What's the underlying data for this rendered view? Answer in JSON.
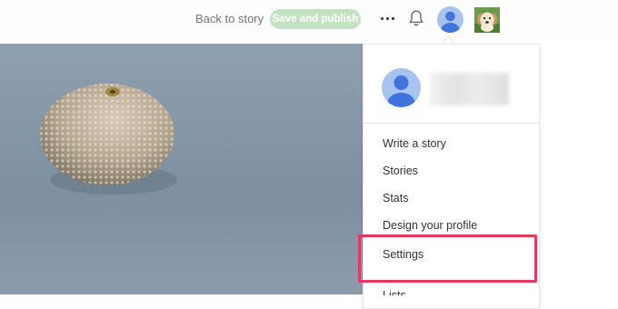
{
  "header": {
    "back_label": "Back to story",
    "publish_label": "Save and publish",
    "icons": {
      "more": "more-icon",
      "notifications": "bell-icon",
      "avatar": "user-avatar",
      "thumbnail": "dog-thumbnail"
    }
  },
  "dropdown": {
    "items": [
      {
        "label": "Write a story"
      },
      {
        "label": "Stories"
      },
      {
        "label": "Stats"
      },
      {
        "label": "Design your profile"
      },
      {
        "label": "Settings"
      },
      {
        "label": "Lists"
      }
    ]
  },
  "colors": {
    "publish_button": "#c2e2c2",
    "avatar": "#a9c3f1",
    "avatar_figure": "#3f74dd",
    "highlight": "#e33a5c",
    "hero_background": "#7d8fa0"
  }
}
